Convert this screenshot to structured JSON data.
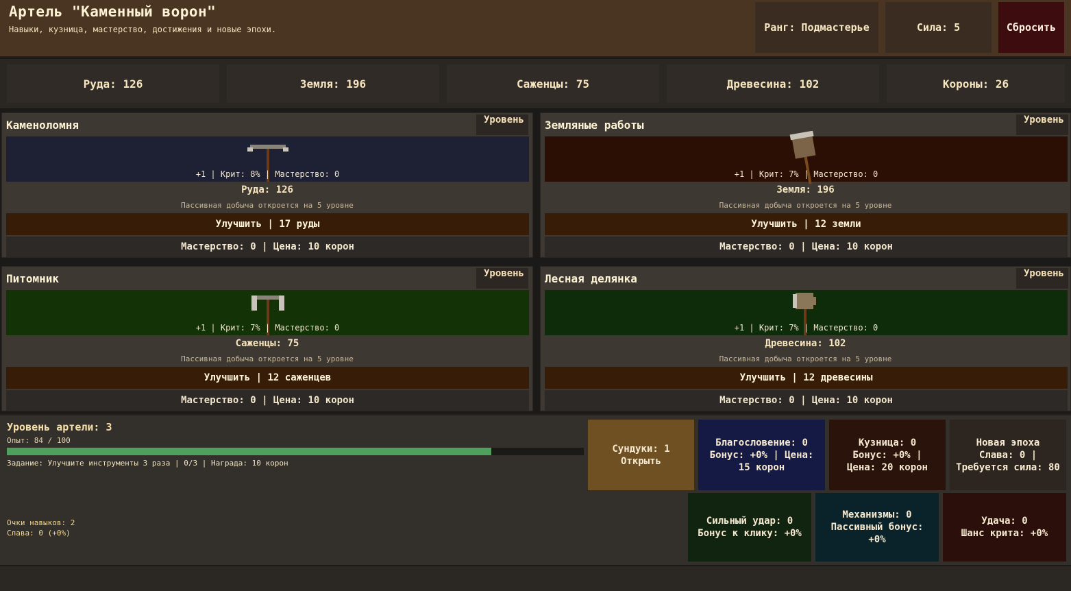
{
  "header": {
    "title": "Артель \"Каменный ворон\"",
    "subtitle": "Навыки, кузница, мастерство, достижения и новые эпохи.",
    "rank": "Ранг: Подмастерье",
    "power": "Сила: 5",
    "reset_label": "Сбросить"
  },
  "resources": [
    {
      "label": "Руда: 126"
    },
    {
      "label": "Земля: 196"
    },
    {
      "label": "Саженцы: 75"
    },
    {
      "label": "Древесина: 102"
    },
    {
      "label": "Короны: 26"
    }
  ],
  "cards": [
    {
      "title": "Каменоломня",
      "level_label": "Уровень",
      "stats": "+1 | Крит: 8% | Мастерство: 0",
      "resource": "Руда: 126",
      "passive": "Пассивная добыча откроется на 5 уровне",
      "upgrade": "Улучшить | 17 руды",
      "mastery": "Мастерство: 0 | Цена: 10 корон",
      "scene_color": "#1d2133",
      "tool_icon": "pickaxe-icon"
    },
    {
      "title": "Земляные работы",
      "level_label": "Уровень",
      "stats": "+1 | Крит: 7% | Мастерство: 0",
      "resource": "Земля: 196",
      "passive": "Пассивная добыча откроется на 5 уровне",
      "upgrade": "Улучшить | 12 земли",
      "mastery": "Мастерство: 0 | Цена: 10 корон",
      "scene_color": "#2b0f04",
      "tool_icon": "shovel-icon"
    },
    {
      "title": "Питомник",
      "level_label": "Уровень",
      "stats": "+1 | Крит: 7% | Мастерство: 0",
      "resource": "Саженцы: 75",
      "passive": "Пассивная добыча откроется на 5 уровне",
      "upgrade": "Улучшить | 12 саженцев",
      "mastery": "Мастерство: 0 | Цена: 10 корон",
      "scene_color": "#133306",
      "tool_icon": "hoe-icon"
    },
    {
      "title": "Лесная делянка",
      "level_label": "Уровень",
      "stats": "+1 | Крит: 7% | Мастерство: 0",
      "resource": "Древесина: 102",
      "passive": "Пассивная добыча откроется на 5 уровне",
      "upgrade": "Улучшить | 12 древесины",
      "mastery": "Мастерство: 0 | Цена: 10 корон",
      "scene_color": "#0f2c0a",
      "tool_icon": "axe-icon"
    }
  ],
  "progress": {
    "level": "Уровень артели: 3",
    "exp_text": "Опыт: 84 / 100",
    "exp_fraction": 0.84,
    "quest": "Задание: Улучшите инструменты 3 раза | 0/3 | Награда: 10 корон",
    "skill_points": "Очки навыков: 2",
    "glory": "Слава: 0 (+0%)"
  },
  "tiles": {
    "chests": "Сундуки: 1\nОткрыть",
    "blessing": "Благословение: 0\nБонус: +0% | Цена: 15 корон",
    "forge": "Кузница: 0\nБонус: +0% |\nЦена: 20 корон",
    "new_era": "Новая эпоха\nСлава: 0 |\nТребуется сила: 80",
    "strong_hit": "Сильный удар: 0\nБонус к клику: +0%",
    "mechanisms": "Механизмы: 0\nПассивный бонус: +0%",
    "luck": "Удача: 0\nШанс крита: +0%"
  },
  "colors": {
    "chests": "#6e5023",
    "blessing": "#141a44",
    "forge": "#2a130a",
    "new_era": "#2d2620",
    "strong_hit": "#102410",
    "mechanisms": "#0a2229",
    "luck": "#2a0f0b",
    "exp_fill": "#4fa05c"
  }
}
